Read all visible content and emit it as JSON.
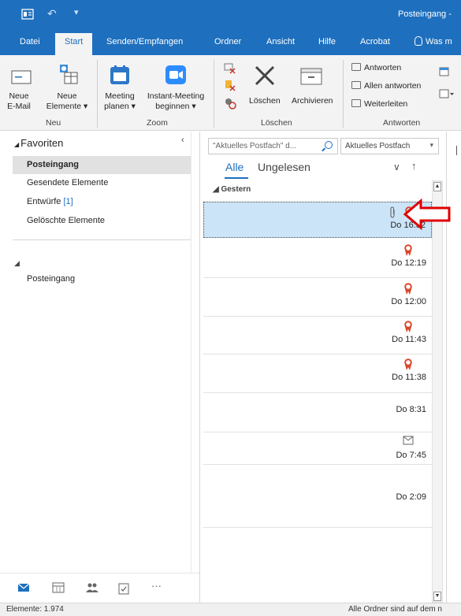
{
  "titlebar": {
    "title": "Posteingang -",
    "undo_glyph": "↶",
    "qa_glyph": "▾"
  },
  "tabs": [
    {
      "label": "Datei"
    },
    {
      "label": "Start"
    },
    {
      "label": "Senden/Empfangen"
    },
    {
      "label": "Ordner"
    },
    {
      "label": "Ansicht"
    },
    {
      "label": "Hilfe"
    },
    {
      "label": "Acrobat"
    }
  ],
  "tab_search": {
    "label": "Was m"
  },
  "ribbon": {
    "new_email_line1": "Neue",
    "new_email_line2": "E-Mail",
    "new_items_line1": "Neue",
    "new_items_line2": "Elemente ▾",
    "group_new": "Neu",
    "meeting_line1": "Meeting",
    "meeting_line2": "planen ▾",
    "instant_line1": "Instant-Meeting",
    "instant_line2": "beginnen ▾",
    "group_zoom": "Zoom",
    "delete_label": "Löschen",
    "archive_label": "Archivieren",
    "group_delete": "Löschen",
    "reply": "Antworten",
    "reply_all": "Allen antworten",
    "forward": "Weiterleiten",
    "group_reply": "Antworten"
  },
  "folders": {
    "favorites_header": "Favoriten",
    "favorites_arrow": "◢",
    "collapse_glyph": "‹",
    "account_arrow": "◢",
    "items": [
      {
        "label": "Posteingang"
      },
      {
        "label": "Gesendete Elemente"
      },
      {
        "label": "Entwürfe",
        "count": "[1]"
      },
      {
        "label": "Gelöschte Elemente"
      }
    ],
    "account_items": [
      {
        "label": "Posteingang"
      }
    ]
  },
  "nav": {
    "more_glyph": "···"
  },
  "msglist": {
    "search_placeholder": "\"Aktuelles Postfach\" d...",
    "scope": "Aktuelles Postfach",
    "scope_dd": "▾",
    "filter_all": "Alle",
    "filter_unread": "Ungelesen",
    "sort_arrow": "∨",
    "sort_dir": "↑",
    "group_header": "◢  Gestern",
    "messages": [
      {
        "time": "Do 16:52",
        "attachment": true,
        "flag": true,
        "selected": true
      },
      {
        "time": "Do 12:19",
        "flag": true
      },
      {
        "time": "Do 12:00",
        "flag": true
      },
      {
        "time": "Do 11:43",
        "flag": true
      },
      {
        "time": "Do 11:38",
        "flag": true
      },
      {
        "time": "Do 8:31"
      },
      {
        "time": "Do 7:45",
        "replied": true
      },
      {
        "time": "Do 2:09"
      }
    ]
  },
  "statusbar": {
    "left": "Elemente: 1.974",
    "right": "Alle Ordner sind auf dem n"
  },
  "colors": {
    "accent": "#1e6fbe",
    "selection": "#cce4f7",
    "flag": "#d9482b",
    "annotation": "#e00000"
  }
}
